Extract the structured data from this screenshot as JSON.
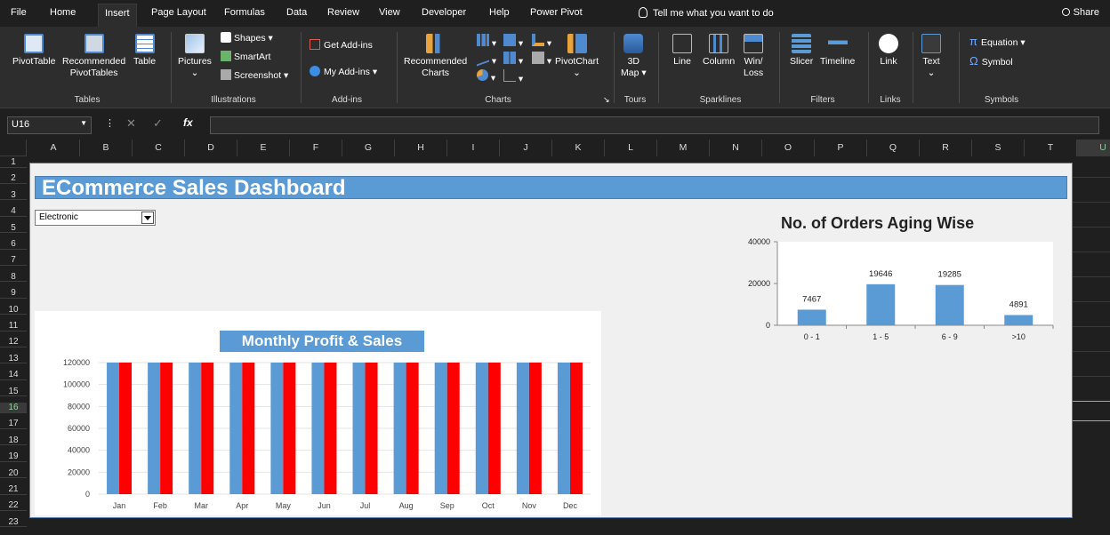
{
  "menu_tabs": [
    "File",
    "Home",
    "Insert",
    "Page Layout",
    "Formulas",
    "Data",
    "Review",
    "View",
    "Developer",
    "Help",
    "Power Pivot"
  ],
  "active_tab": "Insert",
  "tell_me": "Tell me what you want to do",
  "share": "Share",
  "ribbon": {
    "pivottable": "PivotTable",
    "recommended_pivottables_1": "Recommended",
    "recommended_pivottables_2": "PivotTables",
    "table": "Table",
    "pictures": "Pictures",
    "shapes": "Shapes",
    "smartart": "SmartArt",
    "screenshot": "Screenshot",
    "get_addins": "Get Add-ins",
    "my_addins": "My Add-ins",
    "recommended_charts_1": "Recommended",
    "recommended_charts_2": "Charts",
    "pivotchart": "PivotChart",
    "map3d_1": "3D",
    "map3d_2": "Map",
    "line": "Line",
    "column": "Column",
    "winloss_1": "Win/",
    "winloss_2": "Loss",
    "slicer": "Slicer",
    "timeline": "Timeline",
    "link": "Link",
    "text": "Text",
    "equation": "Equation",
    "symbol": "Symbol",
    "groups": {
      "tables": "Tables",
      "illustrations": "Illustrations",
      "addins": "Add-ins",
      "charts": "Charts",
      "tours": "Tours",
      "sparklines": "Sparklines",
      "filters": "Filters",
      "links": "Links",
      "symbols": "Symbols"
    }
  },
  "formula_bar": {
    "name_box": "U16",
    "fx": "fx"
  },
  "columns": [
    "A",
    "B",
    "C",
    "D",
    "E",
    "F",
    "G",
    "H",
    "I",
    "J",
    "K",
    "L",
    "M",
    "N",
    "O",
    "P",
    "Q",
    "R",
    "S",
    "T",
    "U"
  ],
  "rows": [
    "1",
    "2",
    "3",
    "4",
    "5",
    "6",
    "7",
    "8",
    "9",
    "10",
    "11",
    "12",
    "13",
    "14",
    "15",
    "16",
    "17",
    "18",
    "19",
    "20",
    "21",
    "22",
    "23"
  ],
  "selected_cell": {
    "column": "U",
    "row": "16"
  },
  "dashboard": {
    "title": "ECommerce Sales Dashboard",
    "category_selected": "Electronic"
  },
  "colors": {
    "profit": "#5b9bd5",
    "sales": "#ff0000",
    "bar": "#5b9bd5",
    "header": "#5b9bd5"
  },
  "chart_data": [
    {
      "type": "bar",
      "title": "Monthly Profit & Sales",
      "categories": [
        "Jan",
        "Feb",
        "Mar",
        "Apr",
        "May",
        "Jun",
        "Jul",
        "Aug",
        "Sep",
        "Oct",
        "Nov",
        "Dec"
      ],
      "series": [
        {
          "values": [
            120000,
            120000,
            120000,
            120000,
            120000,
            120000,
            120000,
            120000,
            120000,
            120000,
            120000,
            120000
          ]
        },
        {
          "values": [
            120000,
            120000,
            120000,
            120000,
            120000,
            120000,
            120000,
            120000,
            120000,
            120000,
            120000,
            120000
          ]
        }
      ],
      "ylim": [
        0,
        120000
      ],
      "yticks": [
        "0",
        "20000",
        "40000",
        "60000",
        "80000",
        "100000",
        "120000"
      ],
      "xlabel": "",
      "ylabel": ""
    },
    {
      "type": "bar",
      "title": "No. of Orders Aging Wise",
      "categories": [
        "0 - 1",
        "1 - 5",
        "6 - 9",
        ">10"
      ],
      "values": [
        7467,
        19646,
        19285,
        4891
      ],
      "labels": [
        "7467",
        "19646",
        "19285",
        "4891"
      ],
      "ylim": [
        0,
        40000
      ],
      "yticks": [
        "0",
        "20000",
        "40000"
      ],
      "xlabel": "",
      "ylabel": ""
    }
  ]
}
